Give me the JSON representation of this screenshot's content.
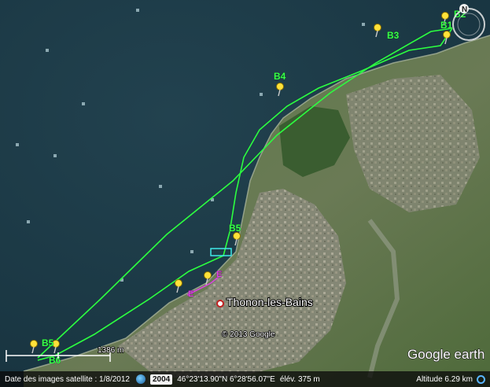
{
  "map": {
    "city_label": "Thonon-les-Bains",
    "copyright": "© 2013 Google",
    "brand": "Google earth",
    "scale_label": "1386 m",
    "compass_north": "N"
  },
  "waypoints": [
    "B1",
    "B2",
    "B3",
    "B4",
    "B5",
    "B5",
    "B6",
    "E",
    "E"
  ],
  "status": {
    "imagery_label": "Date des images satellite : 1/8/2012",
    "year": "2004",
    "coords": "46°23'13.90\"N  6°28'56.07\"E",
    "elev": "élév.  375 m",
    "altitude": "Altitude     6.29 km"
  },
  "colors": {
    "track": "#2cff40",
    "track_alt": "#d946e0",
    "water": "#1d3a46",
    "land": "#4d6a3e"
  }
}
